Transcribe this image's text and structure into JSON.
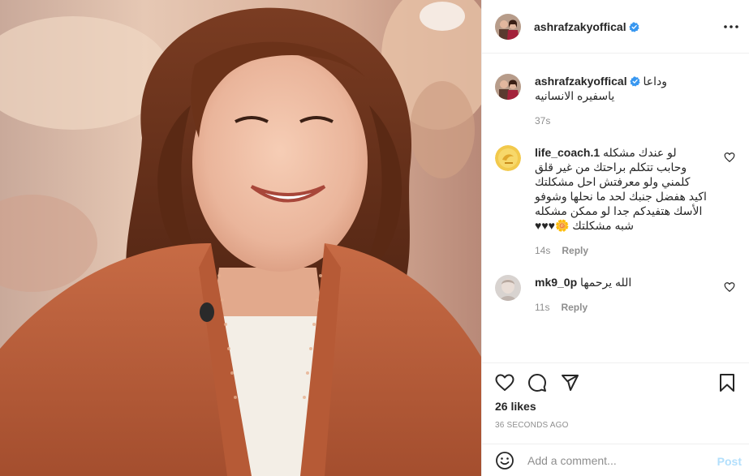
{
  "header": {
    "username": "ashrafzakyoffical",
    "more_icon": "more-horizontal-icon"
  },
  "caption": {
    "username": "ashrafzakyoffical",
    "text": "وداعا ياسفيره الانسانيه",
    "time": "37s"
  },
  "comments": [
    {
      "username": "life_coach.1",
      "text": "لو عندك مشكله وحابب تتكلم براحتك من غير قلق كلمني ولو معرفتش احل مشكلتك اكيد هفضل جنبك لحد ما نحلها وشوفو الأسك هتفيدكم جدا لو ممكن مشكله شبه مشكلتك 🌼♥♥♥",
      "time": "14s",
      "reply_label": "Reply"
    },
    {
      "username": "mk9_0p",
      "text": "الله يرحمها",
      "time": "11s",
      "reply_label": "Reply"
    }
  ],
  "actions": {
    "icons": [
      "heart-icon",
      "comment-icon",
      "share-icon",
      "bookmark-icon"
    ]
  },
  "likes": "26 likes",
  "posted": "36 SECONDS AGO",
  "add_comment": {
    "placeholder": "Add a comment...",
    "post_label": "Post",
    "emoji_icon": "smiley-icon"
  },
  "colors": {
    "verified": "#3897f0",
    "post_disabled": "#b2dffc",
    "muted": "#8e8e8e",
    "text": "#262626"
  }
}
